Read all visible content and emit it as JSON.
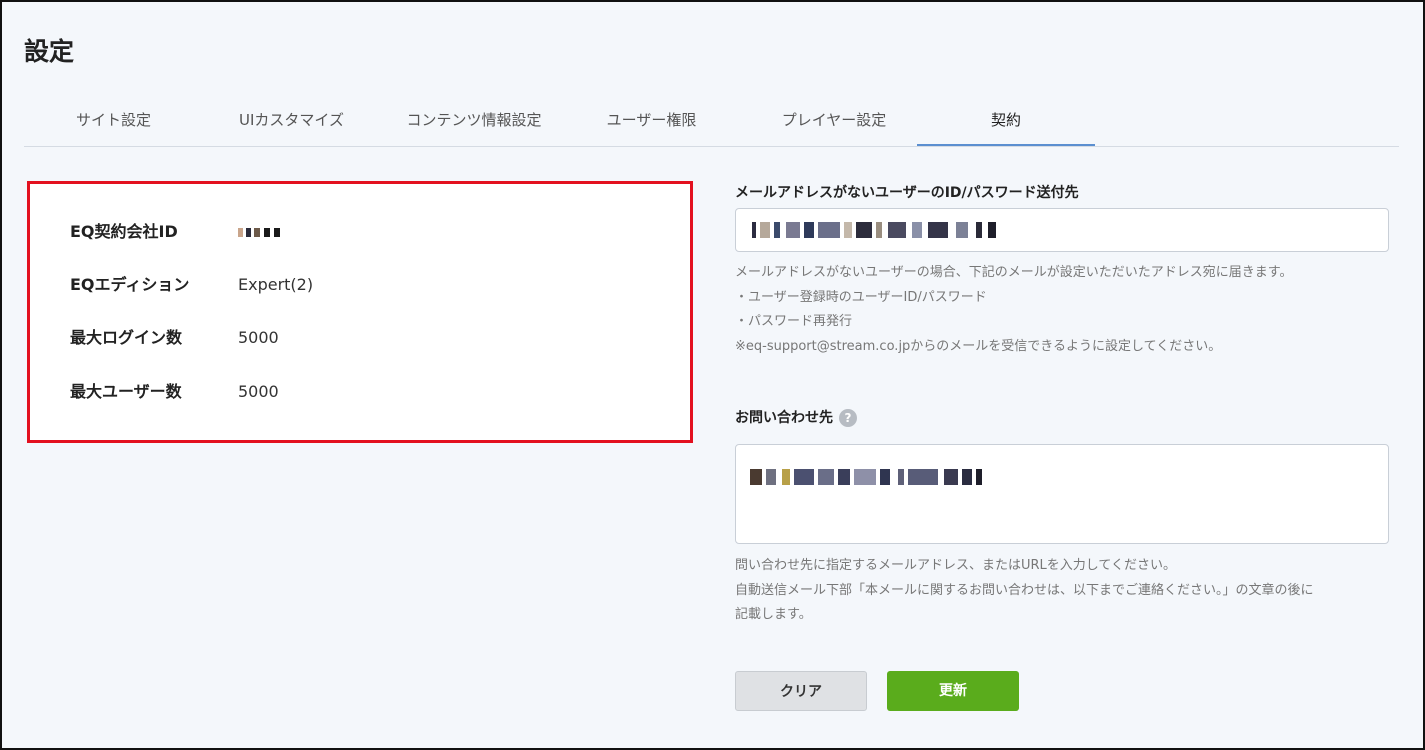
{
  "page": {
    "title": "設定"
  },
  "tabs": [
    {
      "label": "サイト設定",
      "active": false
    },
    {
      "label": "UIカスタマイズ",
      "active": false
    },
    {
      "label": "コンテンツ情報設定",
      "active": false
    },
    {
      "label": "ユーザー権限",
      "active": false
    },
    {
      "label": "プレイヤー設定",
      "active": false
    },
    {
      "label": "契約",
      "active": true
    }
  ],
  "contract": {
    "company_id_label": "EQ契約会社ID",
    "edition_label": "EQエディション",
    "edition_value": "Expert(2)",
    "max_login_label": "最大ログイン数",
    "max_login_value": "5000",
    "max_users_label": "最大ユーザー数",
    "max_users_value": "5000"
  },
  "send_address": {
    "label": "メールアドレスがないユーザーのID/パスワード送付先",
    "help": [
      "メールアドレスがないユーザーの場合、下記のメールが設定いただいたアドレス宛に届きます。",
      "・ユーザー登録時のユーザーID/パスワード",
      "・パスワード再発行",
      "※eq-support@stream.co.jpからのメールを受信できるように設定してください。"
    ]
  },
  "contact": {
    "label": "お問い合わせ先",
    "help_icon_text": "?",
    "help": [
      "問い合わせ先に指定するメールアドレス、またはURLを入力してください。",
      "自動送信メール下部「本メールに関するお問い合わせは、以下までご連絡ください。」の文章の後に",
      "記載します。"
    ]
  },
  "buttons": {
    "clear_label": "クリア",
    "update_label": "更新"
  },
  "colors": {
    "highlight_border": "#e3101f",
    "primary_button": "#5aac1c",
    "active_tab_underline": "#5b8fd0"
  }
}
